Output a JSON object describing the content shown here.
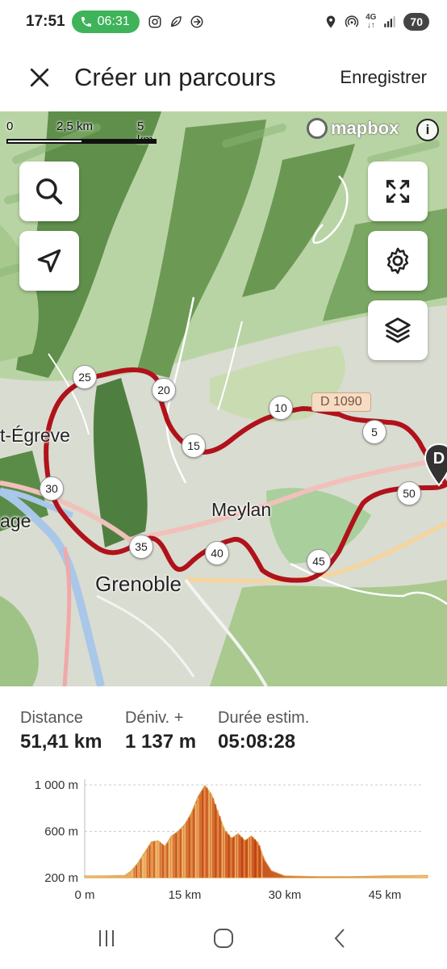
{
  "status_bar": {
    "time": "17:51",
    "call_timer": "06:31",
    "network": "4G",
    "battery": "70"
  },
  "header": {
    "title": "Créer un parcours",
    "save_label": "Enregistrer"
  },
  "map": {
    "scale": {
      "zero": "0",
      "mid": "2,5 km",
      "max": "5 km"
    },
    "attribution": "mapbox",
    "places": {
      "saint_egreve": "t-Égreve",
      "meylan": "Meylan",
      "grenoble": "Grenoble",
      "edge": "age"
    },
    "road": "D 1090",
    "endpoint_letter": "D",
    "km_markers": [
      "5",
      "10",
      "15",
      "20",
      "25",
      "30",
      "35",
      "40",
      "45",
      "50"
    ],
    "route_color": "#b0121b"
  },
  "stats": {
    "distance": {
      "label": "Distance",
      "value": "51,41 km"
    },
    "elevation": {
      "label": "Déniv. +",
      "value": "1 137 m"
    },
    "duration": {
      "label": "Durée estim.",
      "value": "05:08:28"
    }
  },
  "chart_data": {
    "type": "area",
    "title": "",
    "xlabel": "",
    "ylabel": "",
    "x_ticks": [
      "0 m",
      "15 km",
      "30 km",
      "45 km"
    ],
    "y_ticks": [
      "1 000 m",
      "600 m",
      "200 m"
    ],
    "xlim": [
      0,
      51.41
    ],
    "ylim": [
      200,
      1000
    ],
    "grid": true,
    "x": [
      0,
      3,
      6,
      7,
      8,
      9,
      10,
      11,
      12,
      13,
      14,
      15,
      16,
      17,
      18,
      19,
      20,
      21,
      22,
      23,
      24,
      25,
      26,
      27,
      28,
      30,
      35,
      40,
      45,
      51.4
    ],
    "y": [
      215,
      215,
      220,
      260,
      330,
      420,
      510,
      520,
      470,
      560,
      600,
      660,
      760,
      900,
      995,
      920,
      760,
      610,
      540,
      580,
      520,
      560,
      500,
      350,
      260,
      215,
      210,
      210,
      215,
      220
    ]
  }
}
